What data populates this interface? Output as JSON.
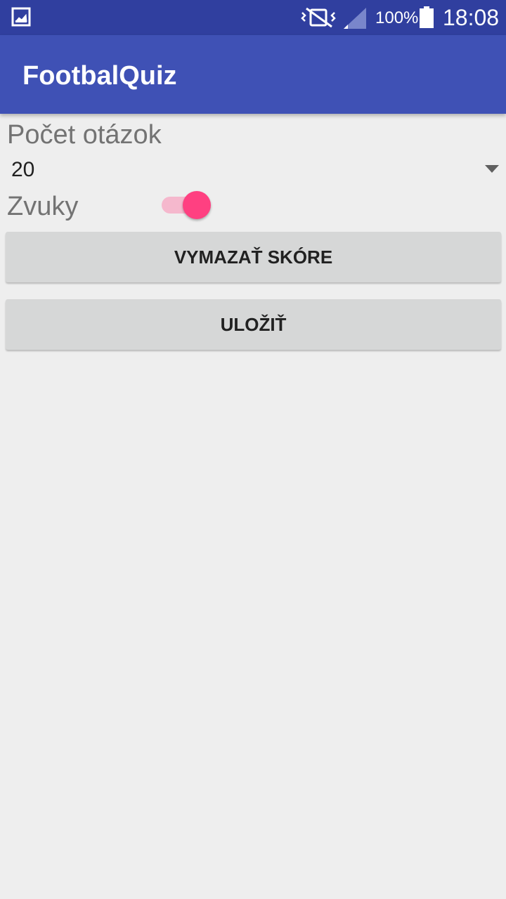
{
  "status_bar": {
    "battery_percent": "100%",
    "time": "18:08",
    "icons": [
      "gallery-icon",
      "vibrate-icon",
      "signal-icon",
      "battery-icon"
    ]
  },
  "app_bar": {
    "title": "FootbalQuiz",
    "color": "#3f51b5",
    "status_color": "#303f9f"
  },
  "settings": {
    "question_count_label": "Počet otázok",
    "question_count_value": "20",
    "sounds_label": "Zvuky",
    "sounds_enabled": true,
    "accent_color": "#ff4081"
  },
  "buttons": {
    "clear_score": "VYMAZAŤ SKÓRE",
    "save": "ULOŽIŤ"
  }
}
